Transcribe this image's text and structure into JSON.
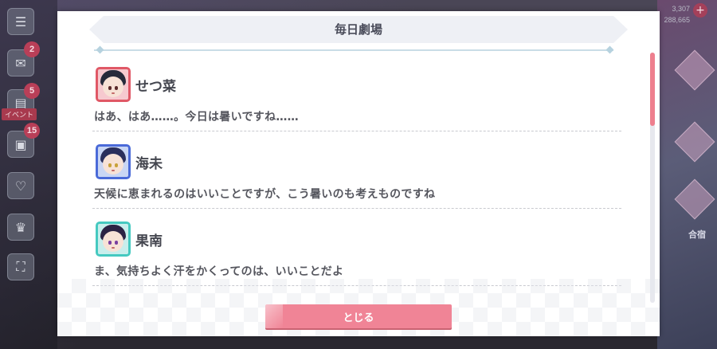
{
  "background": {
    "top_right_info": [
      "3,307",
      "288,665"
    ],
    "event_tag": "イベント",
    "rail_badges": [
      "2",
      "5",
      "15"
    ],
    "right_label": "合宿"
  },
  "dialog": {
    "title": "毎日劇場",
    "entries": [
      {
        "speaker": "せつ菜",
        "line": "はあ、はあ……。今日は暑いですね……",
        "avatar_ring_color": "#e05866",
        "avatar_bg": "#f6c9cf",
        "hair_color": "#262a3a"
      },
      {
        "speaker": "海未",
        "line": "天候に恵まれるのはいいことですが、こう暑いのも考えものですね",
        "avatar_ring_color": "#4a6ad8",
        "avatar_bg": "#c9d6f4",
        "hair_color": "#2a2f5c"
      },
      {
        "speaker": "果南",
        "line": "ま、気持ちよく汗をかくってのは、いいことだよ",
        "avatar_ring_color": "#45c9c0",
        "avatar_bg": "#c8eeec",
        "hair_color": "#2b2344"
      }
    ],
    "close_label": "とじる"
  },
  "colors": {
    "accent_pink": "#f08496",
    "scroll_thumb": "#ee7f8e",
    "header_bg": "#eef0f5"
  }
}
